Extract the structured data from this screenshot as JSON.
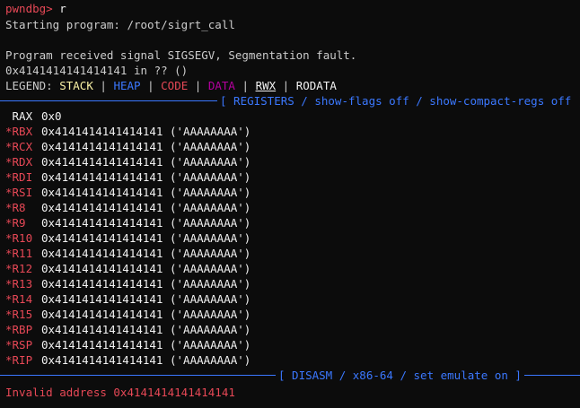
{
  "prompt": "pwndbg>",
  "command": "r",
  "starting": "Starting program: /root/sigrt_call",
  "signal_msg": "Program received signal SIGSEGV, Segmentation fault.",
  "location": "0x4141414141414141 in ?? ()",
  "legend": {
    "label": "LEGEND:",
    "stack": "STACK",
    "heap": "HEAP",
    "code": "CODE",
    "data": "DATA",
    "rwx": "RWX",
    "rodata": "RODATA",
    "sep": "|"
  },
  "registers_banner": "[ REGISTERS / show-flags off / show-compact-regs off ]",
  "registers": [
    {
      "name": " RAX",
      "value": "0x0",
      "changed": false
    },
    {
      "name": "*RBX",
      "value": "0x4141414141414141 ('AAAAAAAA')",
      "changed": true
    },
    {
      "name": "*RCX",
      "value": "0x4141414141414141 ('AAAAAAAA')",
      "changed": true
    },
    {
      "name": "*RDX",
      "value": "0x4141414141414141 ('AAAAAAAA')",
      "changed": true
    },
    {
      "name": "*RDI",
      "value": "0x4141414141414141 ('AAAAAAAA')",
      "changed": true
    },
    {
      "name": "*RSI",
      "value": "0x4141414141414141 ('AAAAAAAA')",
      "changed": true
    },
    {
      "name": "*R8",
      "value": "0x4141414141414141 ('AAAAAAAA')",
      "changed": true
    },
    {
      "name": "*R9",
      "value": "0x4141414141414141 ('AAAAAAAA')",
      "changed": true
    },
    {
      "name": "*R10",
      "value": "0x4141414141414141 ('AAAAAAAA')",
      "changed": true
    },
    {
      "name": "*R11",
      "value": "0x4141414141414141 ('AAAAAAAA')",
      "changed": true
    },
    {
      "name": "*R12",
      "value": "0x4141414141414141 ('AAAAAAAA')",
      "changed": true
    },
    {
      "name": "*R13",
      "value": "0x4141414141414141 ('AAAAAAAA')",
      "changed": true
    },
    {
      "name": "*R14",
      "value": "0x4141414141414141 ('AAAAAAAA')",
      "changed": true
    },
    {
      "name": "*R15",
      "value": "0x4141414141414141 ('AAAAAAAA')",
      "changed": true
    },
    {
      "name": "*RBP",
      "value": "0x4141414141414141 ('AAAAAAAA')",
      "changed": true
    },
    {
      "name": "*RSP",
      "value": "0x4141414141414141 ('AAAAAAAA')",
      "changed": true
    },
    {
      "name": "*RIP",
      "value": "0x4141414141414141 ('AAAAAAAA')",
      "changed": true
    }
  ],
  "disasm_banner": "[ DISASM / x86-64 / set emulate on ]",
  "error": "Invalid address 0x4141414141414141",
  "colors": {
    "background": "#0c0c0c",
    "text": "#cccccc",
    "changed_register": "#e74856",
    "stack": "#f9f1a5",
    "heap": "#3b78ff",
    "code": "#e74856",
    "data": "#b4009e",
    "banner": "#3b78ff"
  }
}
